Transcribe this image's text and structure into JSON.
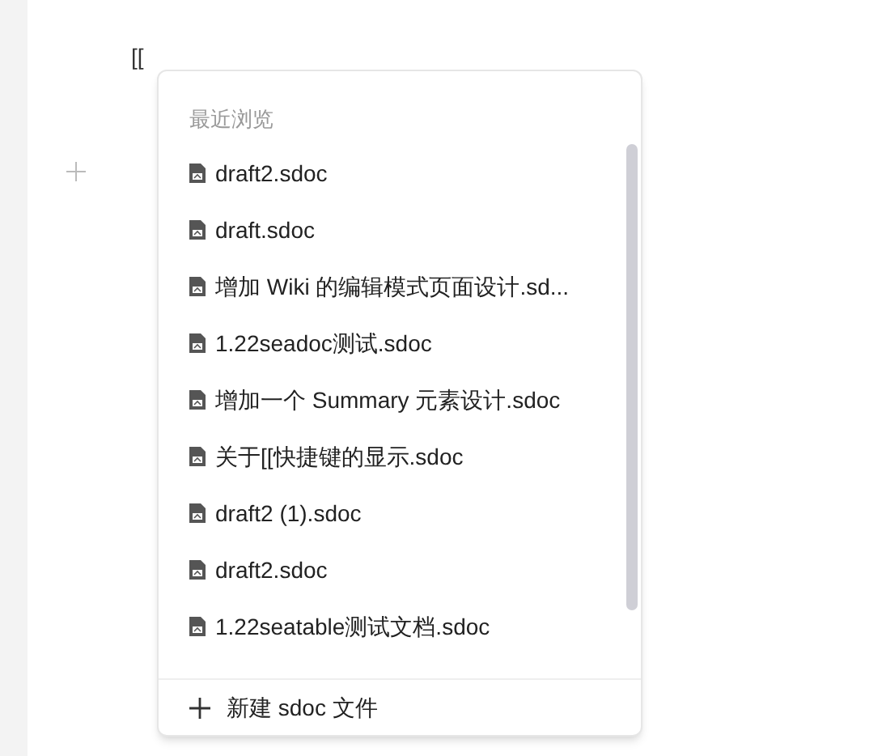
{
  "editor": {
    "typed_text": "[["
  },
  "popup": {
    "section_title": "最近浏览",
    "items": [
      {
        "label": "draft2.sdoc"
      },
      {
        "label": "draft.sdoc"
      },
      {
        "label": "增加 Wiki 的编辑模式页面设计.sd..."
      },
      {
        "label": "1.22seadoc测试.sdoc"
      },
      {
        "label": "增加一个 Summary 元素设计.sdoc"
      },
      {
        "label": "关于[[快捷键的显示.sdoc"
      },
      {
        "label": "draft2 (1).sdoc"
      },
      {
        "label": "draft2.sdoc"
      },
      {
        "label": "1.22seatable测试文档.sdoc"
      }
    ],
    "footer_action": "新建 sdoc 文件"
  }
}
